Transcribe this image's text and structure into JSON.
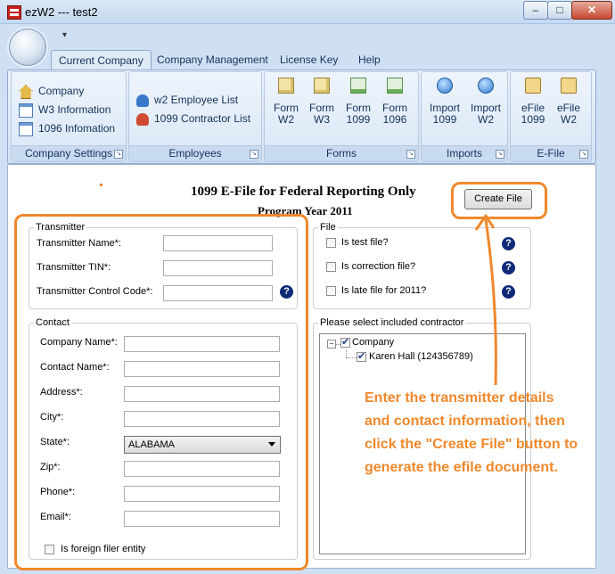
{
  "window": {
    "title": "ezW2 --- test2",
    "minimize": "–",
    "maximize": "□",
    "close": "✕"
  },
  "ribbon": {
    "qat_arrow": "▾",
    "tabs": [
      "Current Company",
      "Company Management",
      "License Key",
      "Help"
    ],
    "groups": {
      "company_settings": {
        "label": "Company Settings",
        "items": [
          "Company",
          "W3 Information",
          "1096 Infomation"
        ]
      },
      "employees": {
        "label": "Employees",
        "items": [
          "w2 Employee List",
          "1099 Contractor List"
        ]
      },
      "forms": {
        "label": "Forms",
        "items": [
          {
            "line1": "Form",
            "line2": "W2"
          },
          {
            "line1": "Form",
            "line2": "W3"
          },
          {
            "line1": "Form",
            "line2": "1099"
          },
          {
            "line1": "Form",
            "line2": "1096"
          }
        ]
      },
      "imports": {
        "label": "Imports",
        "items": [
          {
            "line1": "Import",
            "line2": "1099"
          },
          {
            "line1": "Import",
            "line2": "W2"
          }
        ]
      },
      "efile": {
        "label": "E-File",
        "items": [
          {
            "line1": "eFile",
            "line2": "1099"
          },
          {
            "line1": "eFile",
            "line2": "W2"
          }
        ]
      }
    }
  },
  "page": {
    "title": "1099 E-File for Federal Reporting Only",
    "subtitle": "Program Year 2011",
    "create_button": "Create File",
    "help_glyph": "?",
    "transmitter": {
      "legend": "Transmitter",
      "name_label": "Transmitter Name*:",
      "name_value": "",
      "tin_label": "Transmitter TIN*:",
      "tin_value": "",
      "tcc_label": "Transmitter Control Code*:",
      "tcc_value": ""
    },
    "contact": {
      "legend": "Contact",
      "company_name_label": "Company Name*:",
      "contact_name_label": "Contact Name*:",
      "address_label": "Address*:",
      "city_label": "City*:",
      "state_label": "State*:",
      "state_value": "ALABAMA",
      "zip_label": "Zip*:",
      "phone_label": "Phone*:",
      "email_label": "Email*:",
      "foreign_label": "Is foreign filer entity",
      "foreign_checked": false
    },
    "file": {
      "legend": "File",
      "test_label": "Is test file?",
      "correction_label": "Is correction file?",
      "late_label": "Is late file for 2011?"
    },
    "contractors": {
      "legend": "Please select included contractor",
      "root": "Company",
      "root_checked": true,
      "children": [
        {
          "label": "Karen Hall (124356789)",
          "checked": true
        }
      ]
    },
    "annotation": {
      "note": "Enter the transmitter details and contact information, then click the \"Create File\" button to generate the efile document.",
      "accent_color": "#f0882c"
    }
  }
}
